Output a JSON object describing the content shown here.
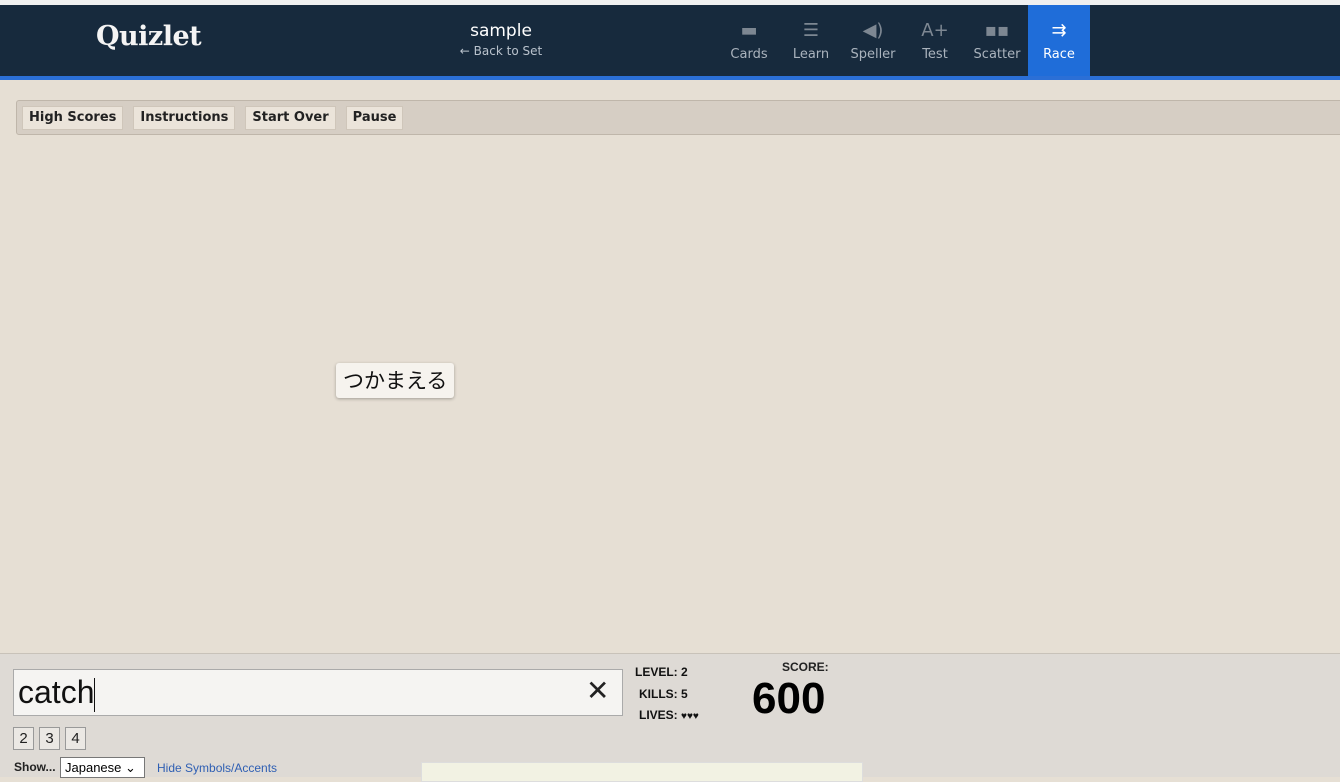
{
  "header": {
    "logo": "Quizlet",
    "set_title": "sample",
    "back_link": "← Back to Set",
    "nav": [
      {
        "label": "Cards",
        "icon": "cards-icon"
      },
      {
        "label": "Learn",
        "icon": "learn-icon"
      },
      {
        "label": "Speller",
        "icon": "speaker-icon"
      },
      {
        "label": "Test",
        "icon": "test-icon"
      },
      {
        "label": "Scatter",
        "icon": "scatter-icon"
      },
      {
        "label": "Race",
        "icon": "race-icon",
        "active": true
      }
    ]
  },
  "toolbar": {
    "high_scores": "High Scores",
    "instructions": "Instructions",
    "start_over": "Start Over",
    "pause": "Pause"
  },
  "game": {
    "term": "つかまえる"
  },
  "bottom": {
    "answer": "catch",
    "level_label": "LEVEL:",
    "level": "2",
    "kills_label": "KILLS:",
    "kills": "5",
    "lives_label": "LIVES:",
    "lives": "♥♥♥",
    "score_label": "SCORE:",
    "score": "600",
    "number_buttons": [
      "2",
      "3",
      "4"
    ],
    "show_label": "Show...",
    "show_value": "Japanese",
    "hide_symbols": "Hide Symbols/Accents"
  },
  "colors": {
    "header": "#172a3d",
    "accent": "#1f6dd9"
  }
}
